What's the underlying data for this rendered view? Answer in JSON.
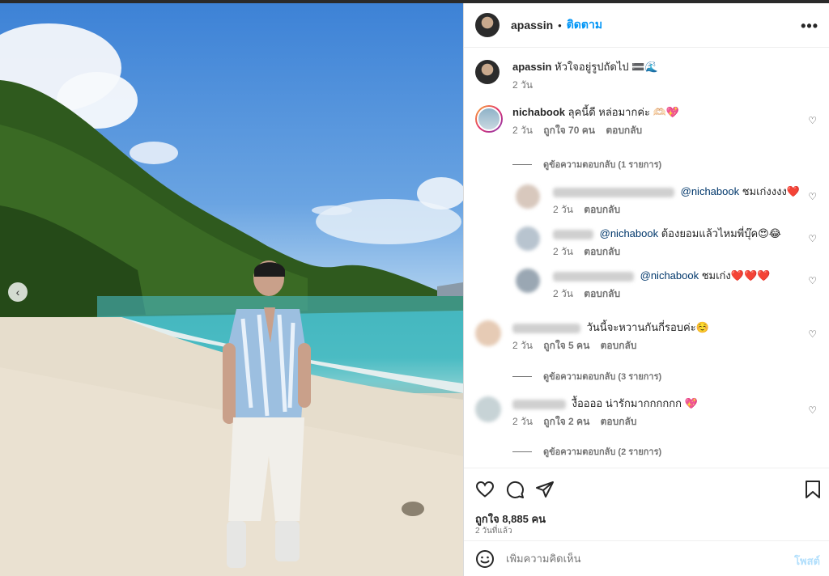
{
  "header": {
    "username": "apassin",
    "separator": "•",
    "follow_label": "ติดตาม",
    "more_icon": "more-horizontal-icon"
  },
  "caption": {
    "username": "apassin",
    "text": "หัวใจอยู่รูปถัดไป 🟰🌊",
    "time": "2 วัน"
  },
  "comments": [
    {
      "username": "nichabook",
      "text": "ลุคนี้ดี หล่อมากค่ะ 🫶🏻💖",
      "time": "2 วัน",
      "likes": "ถูกใจ 70 คน",
      "reply_label": "ตอบกลับ",
      "view_replies": "ดูข้อความตอบกลับ (1 รายการ)",
      "replies": [
        {
          "mention": "@nichabook",
          "text": "ชมเก่งงงง❤️",
          "time": "2 วัน",
          "reply_label": "ตอบกลับ"
        },
        {
          "mention": "@nichabook",
          "text": "ต้องยอมแล้วไหมพี่บุ๊ค😍😂",
          "time": "2 วัน",
          "reply_label": "ตอบกลับ"
        },
        {
          "mention": "@nichabook",
          "text": "ชมเก่ง❤️❤️❤️",
          "time": "2 วัน",
          "reply_label": "ตอบกลับ"
        }
      ]
    },
    {
      "text": "วันนี้จะหวานกันกี่รอบค่ะ☺️",
      "time": "2 วัน",
      "likes": "ถูกใจ 5 คน",
      "reply_label": "ตอบกลับ",
      "view_replies": "ดูข้อความตอบกลับ (3 รายการ)"
    },
    {
      "text": "งื้ออออ น่ารักมากกกกกก 💖",
      "time": "2 วัน",
      "likes": "ถูกใจ 2 คน",
      "reply_label": "ตอบกลับ",
      "view_replies": "ดูข้อความตอบกลับ (2 รายการ)"
    }
  ],
  "actions": {
    "likes": "ถูกใจ 8,885 คน",
    "time": "2 วันที่แล้ว"
  },
  "add_comment": {
    "placeholder": "เพิ่มความคิดเห็น",
    "post_label": "โพสต์"
  },
  "colors": {
    "accent": "#0095f6",
    "mention": "#00376b",
    "muted": "#737373"
  }
}
